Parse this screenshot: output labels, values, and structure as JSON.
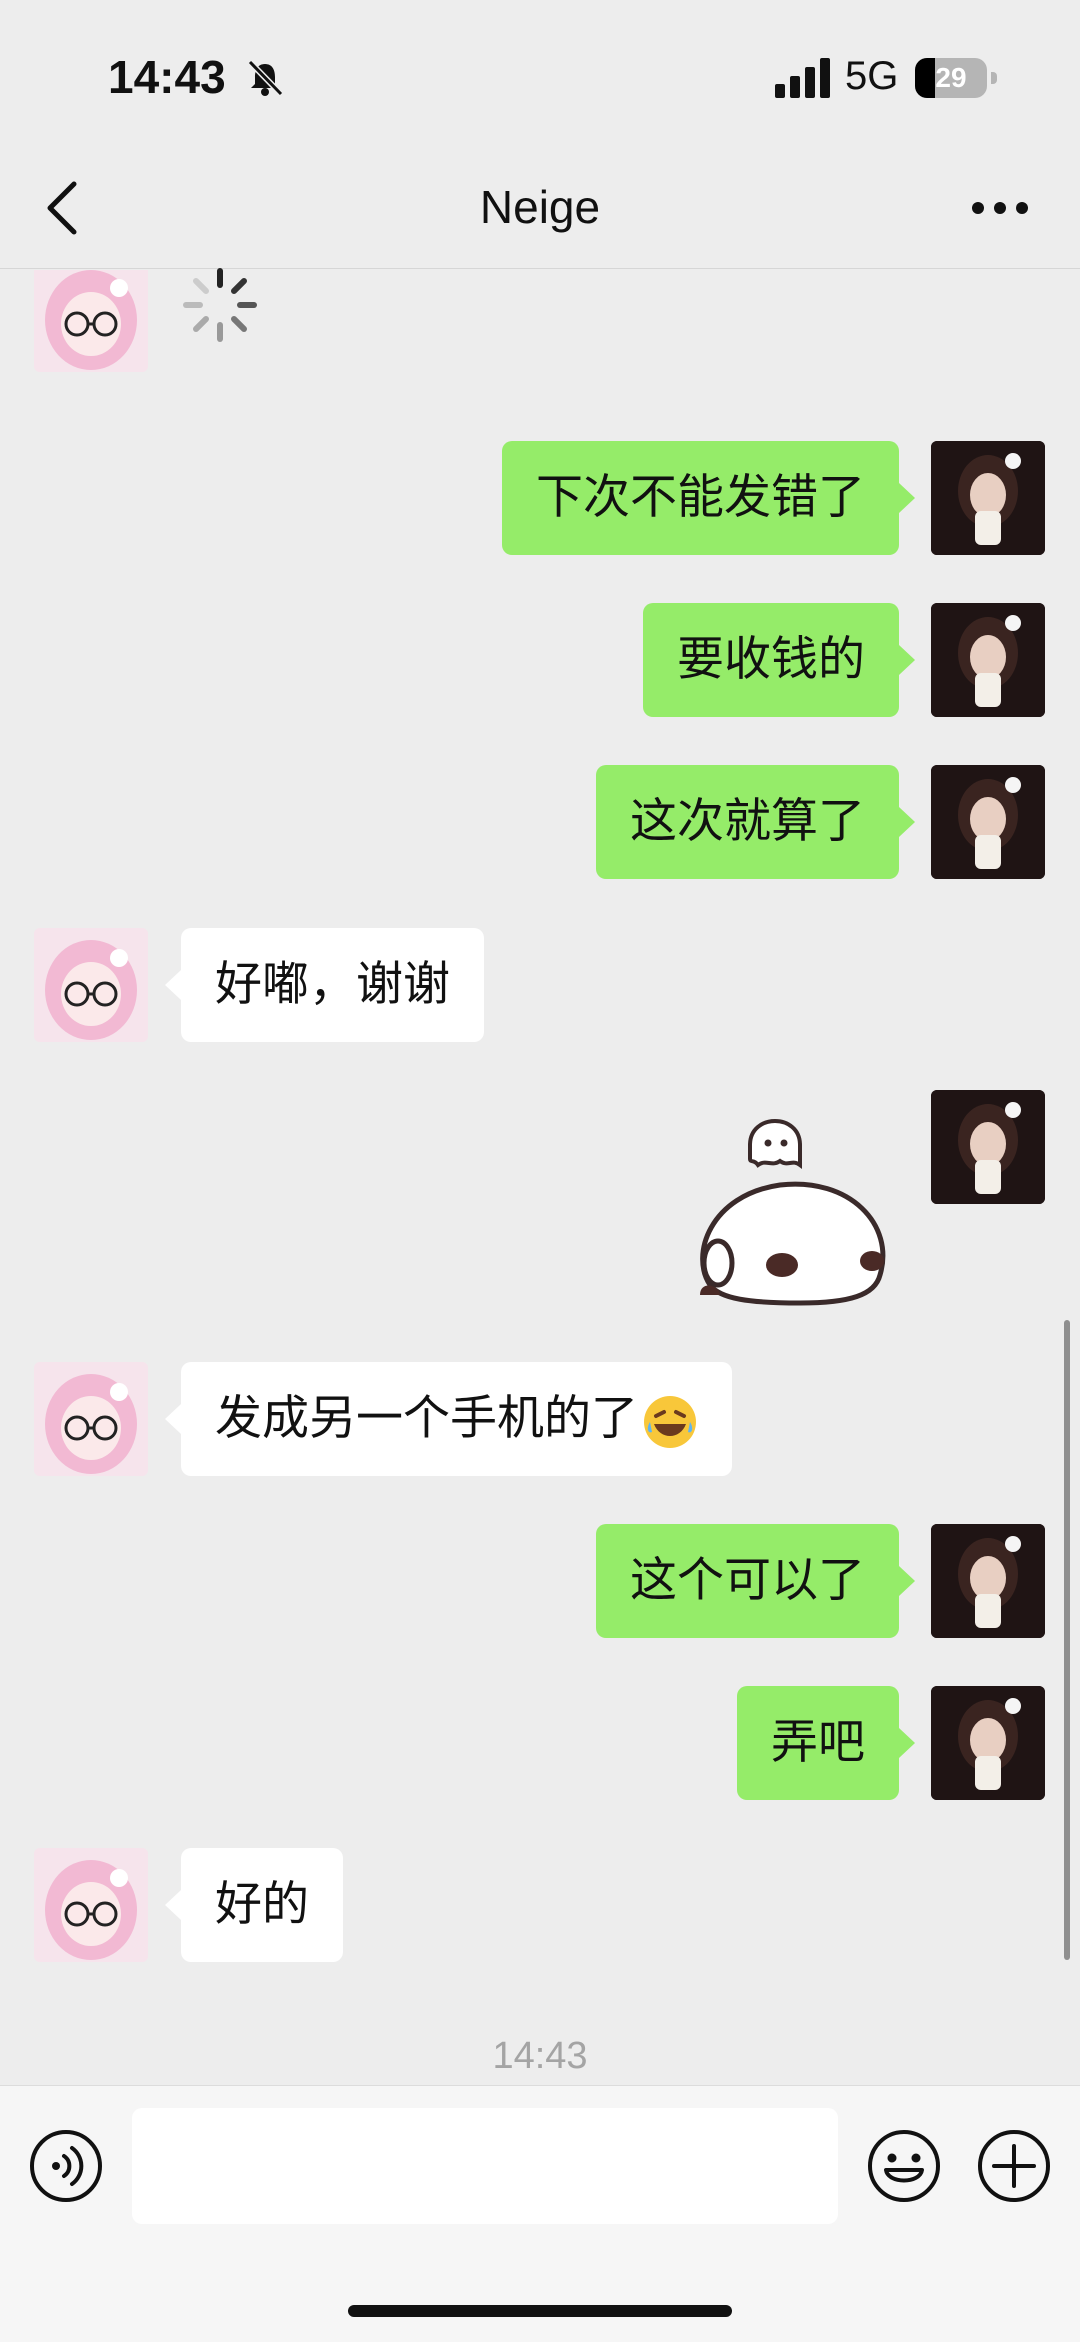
{
  "status_bar": {
    "time": "14:43",
    "network": "5G",
    "battery": "29"
  },
  "header": {
    "title": "Neige"
  },
  "messages": [
    {
      "side": "them",
      "kind": "loading"
    },
    {
      "side": "me",
      "text": "下次不能发错了"
    },
    {
      "side": "me",
      "text": "要收钱的"
    },
    {
      "side": "me",
      "text": "这次就算了"
    },
    {
      "side": "them",
      "text": "好嘟，谢谢"
    },
    {
      "side": "me",
      "kind": "sticker",
      "icon": "panda-ghost-sticker"
    },
    {
      "side": "them",
      "text": "发成另一个手机的了",
      "emoji": "rolling-laughing-emoji"
    },
    {
      "side": "me",
      "text": "这个可以了"
    },
    {
      "side": "me",
      "text": "弄吧"
    },
    {
      "side": "them",
      "text": "好的"
    }
  ],
  "timestamp": "14:43",
  "input": {
    "value": "",
    "placeholder": ""
  },
  "colors": {
    "background": "#ededed",
    "my_bubble": "#95ec69",
    "their_bubble": "#ffffff"
  }
}
